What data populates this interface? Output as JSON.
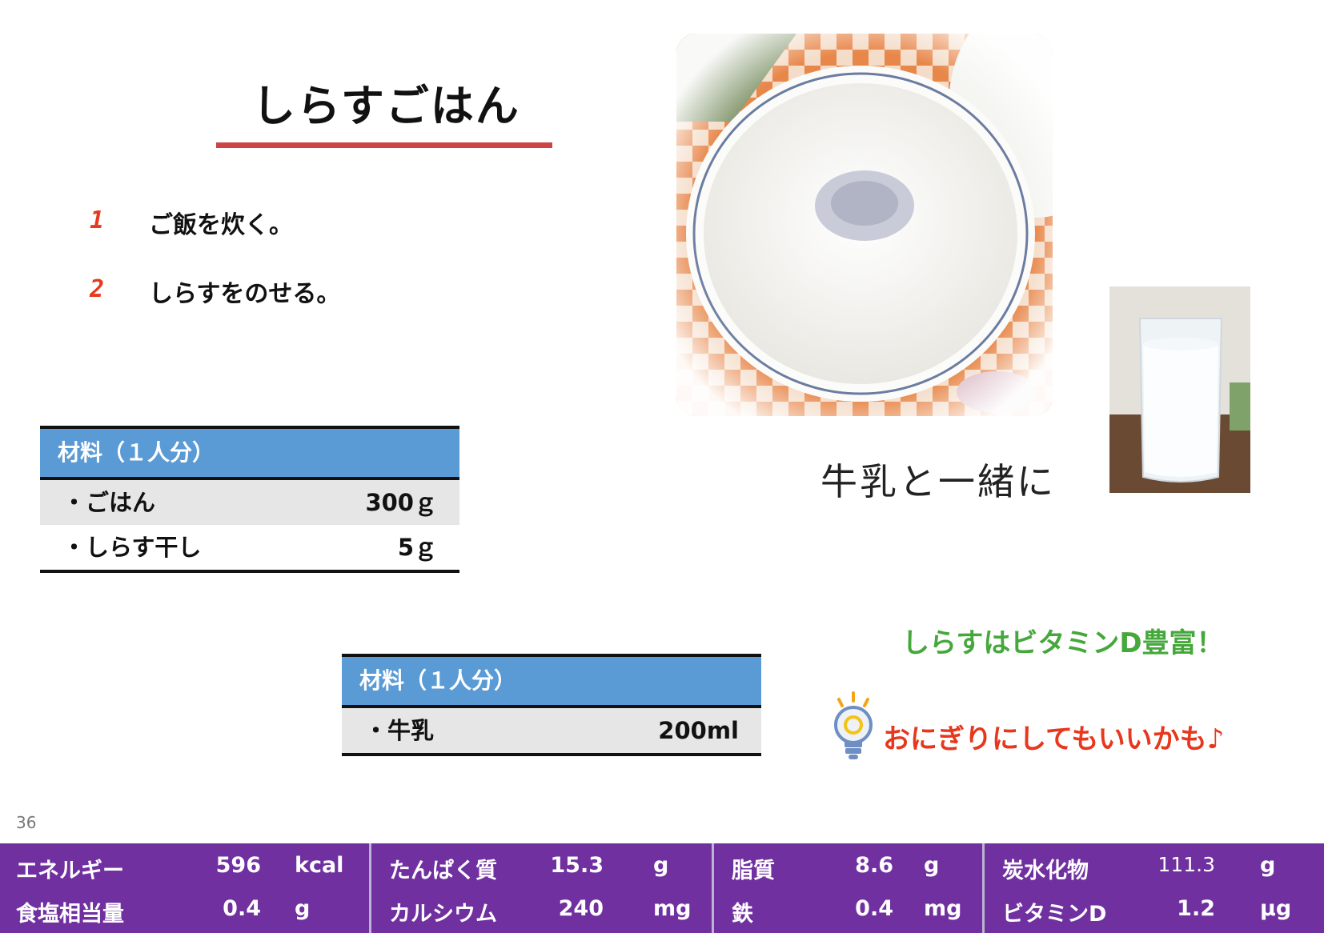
{
  "title": "しらすごはん",
  "steps": [
    {
      "num": "1",
      "text": "ご飯を炊く。"
    },
    {
      "num": "2",
      "text": "しらすをのせる。"
    }
  ],
  "ingredients_main": {
    "header": "材料（１人分）",
    "rows": [
      {
        "name": "・ごはん",
        "amount": "300ｇ"
      },
      {
        "name": "・しらす干し",
        "amount": "5ｇ"
      }
    ]
  },
  "ingredients_side": {
    "header": "材料（１人分）",
    "rows": [
      {
        "name": "・牛乳",
        "amount": "200ml"
      }
    ]
  },
  "milk_caption": "牛乳と一緒に",
  "notes": {
    "vitamin_d": "しらすはビタミンD豊富！",
    "onigiri": "おにぎりにしてもいいかも♪"
  },
  "page_number": "36",
  "nutrition": [
    {
      "label": "エネルギー",
      "value": "596",
      "unit": "kcal"
    },
    {
      "label": "たんぱく質",
      "value": "15.3",
      "unit": "g"
    },
    {
      "label": "脂質",
      "value": "8.6",
      "unit": "g"
    },
    {
      "label": "炭水化物",
      "value": "111.3",
      "unit": "g"
    },
    {
      "label": "食塩相当量",
      "value": "0.4",
      "unit": "g"
    },
    {
      "label": "カルシウム",
      "value": "240",
      "unit": "mg"
    },
    {
      "label": "鉄",
      "value": "0.4",
      "unit": "mg"
    },
    {
      "label": "ビタミンD",
      "value": "1.2",
      "unit": "μg"
    }
  ],
  "colors": {
    "title_underline": "#cc4444",
    "table_header": "#5b9bd5",
    "nutrition_bg": "#7030a0",
    "vitamin_note": "#46a83c",
    "onigiri_note": "#e8371c",
    "step_number": "#e63a1f"
  }
}
